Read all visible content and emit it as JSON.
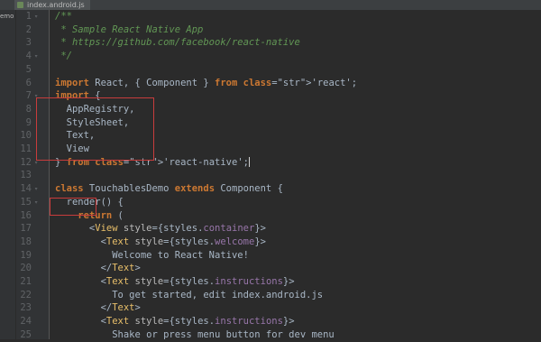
{
  "tab": {
    "file_name": "index.android.js"
  },
  "side_panel": {
    "label": "emo"
  },
  "lines": [
    {
      "n": "1",
      "text": "/**",
      "cls": "cm"
    },
    {
      "n": "2",
      "text": " * Sample React Native App",
      "cls": "cm"
    },
    {
      "n": "3",
      "text": " * https://github.com/facebook/react-native",
      "cls": "cm"
    },
    {
      "n": "4",
      "text": " */",
      "cls": "cm"
    },
    {
      "n": "5",
      "text": ""
    },
    {
      "n": "6",
      "text": "import React, { Component } from 'react';"
    },
    {
      "n": "7",
      "text": "import {"
    },
    {
      "n": "8",
      "text": "  AppRegistry,"
    },
    {
      "n": "9",
      "text": "  StyleSheet,"
    },
    {
      "n": "10",
      "text": "  Text,"
    },
    {
      "n": "11",
      "text": "  View"
    },
    {
      "n": "12",
      "text": "} from 'react-native';"
    },
    {
      "n": "13",
      "text": ""
    },
    {
      "n": "14",
      "text": "class TouchablesDemo extends Component {"
    },
    {
      "n": "15",
      "text": "  render() {"
    },
    {
      "n": "16",
      "text": "    return ("
    },
    {
      "n": "17",
      "text": "      <View style={styles.container}>"
    },
    {
      "n": "18",
      "text": "        <Text style={styles.welcome}>"
    },
    {
      "n": "19",
      "text": "          Welcome to React Native!"
    },
    {
      "n": "20",
      "text": "        </Text>"
    },
    {
      "n": "21",
      "text": "        <Text style={styles.instructions}>"
    },
    {
      "n": "22",
      "text": "          To get started, edit index.android.js"
    },
    {
      "n": "23",
      "text": "        </Text>"
    },
    {
      "n": "24",
      "text": "        <Text style={styles.instructions}>"
    },
    {
      "n": "25",
      "text": "          Shake or press menu button for dev menu"
    }
  ]
}
